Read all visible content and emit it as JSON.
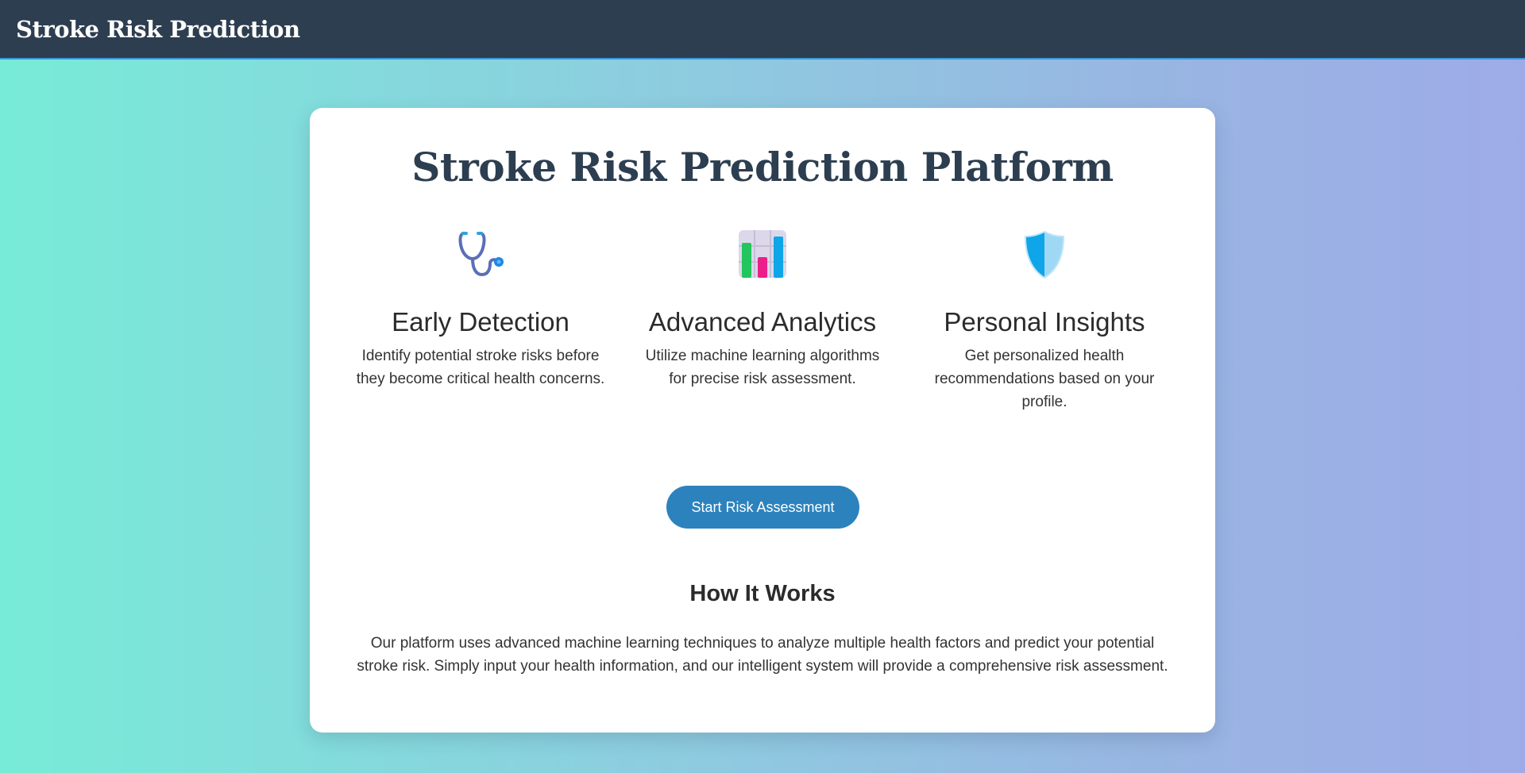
{
  "nav": {
    "brand": "Stroke Risk Prediction"
  },
  "hero": {
    "title": "Stroke Risk Prediction Platform"
  },
  "features": [
    {
      "icon": "stethoscope-icon",
      "title": "Early Detection",
      "text": "Identify potential stroke risks before they become critical health concerns."
    },
    {
      "icon": "bar-chart-icon",
      "title": "Advanced Analytics",
      "text": "Utilize machine learning algorithms for precise risk assessment."
    },
    {
      "icon": "shield-icon",
      "title": "Personal Insights",
      "text": "Get personalized health recommendations based on your profile."
    }
  ],
  "cta": {
    "label": "Start Risk Assessment"
  },
  "how": {
    "title": "How It Works",
    "text": "Our platform uses advanced machine learning techniques to analyze multiple health factors and predict your potential stroke risk. Simply input your health information, and our intelligent system will provide a comprehensive risk assessment."
  },
  "colors": {
    "navbar": "#2d3e50",
    "accent": "#2c82bd",
    "title": "#2c3e50"
  }
}
